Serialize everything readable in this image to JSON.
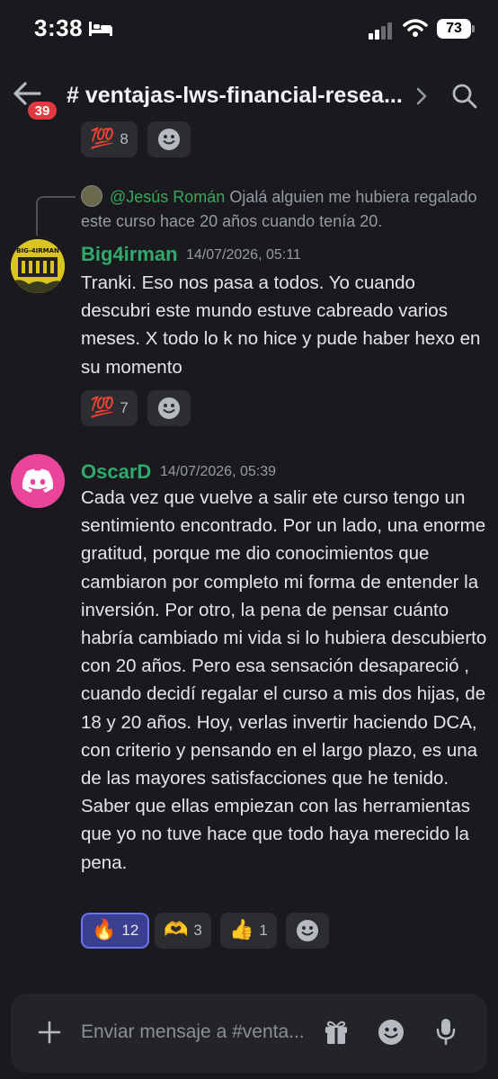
{
  "status_bar": {
    "time": "3:38",
    "battery": "73"
  },
  "header": {
    "unread_badge": "39",
    "channel_name": "# ventajas-lws-financial-resea..."
  },
  "prev_reactions": [
    {
      "emoji": "💯",
      "count": "8"
    }
  ],
  "reply": {
    "author": "@Jesús Román",
    "text": "Ojalá alguien me hubiera regalado este curso hace 20 años cuando tenía 20."
  },
  "messages": [
    {
      "author": "Big4irman",
      "timestamp": "14/07/2026, 05:11",
      "text": "Tranki. Eso nos pasa a todos. Yo cuando descubri este mundo estuve cabreado varios meses. X todo lo k no hice y pude haber hexo en su momento",
      "avatar_text": "BIG-4IRMAN",
      "reactions": [
        {
          "emoji": "💯",
          "count": "7"
        }
      ]
    },
    {
      "author": "OscarD",
      "timestamp": "14/07/2026, 05:39",
      "text": "Cada vez que vuelve a salir ete curso tengo un sentimiento encontrado. Por un lado, una enorme gratitud, porque me dio conocimientos que cambiaron por completo mi forma de entender   la inversión. Por otro, la pena de pensar cuánto habría cambiado mi vida si lo hubiera descubierto con 20 años. Pero esa sensación desapareció , cuando decidí regalar el curso a mis dos hijas, de 18 y 20 años. Hoy, verlas invertir haciendo DCA, con criterio y pensando en el largo plazo, es una de las mayores satisfacciones que he tenido. Saber que ellas empiezan con las herramientas que yo no tuve hace que todo haya merecido la pena.",
      "reactions": [
        {
          "emoji": "🔥",
          "count": "12",
          "active": true
        },
        {
          "emoji": "🫶",
          "count": "3"
        },
        {
          "emoji": "👍",
          "count": "1"
        }
      ]
    }
  ],
  "composer": {
    "placeholder": "Enviar mensaje a #venta..."
  },
  "colors": {
    "background": "#1a1a1e",
    "author_green": "#2faa6b",
    "badge_red": "#e0393e",
    "active_reaction": "#3b3f8f",
    "discord_pink": "#ea459a"
  },
  "icons": [
    "back-arrow-icon",
    "chevron-right-icon",
    "search-icon",
    "smiley-add-icon",
    "discord-logo-icon",
    "plus-icon",
    "gift-icon",
    "emoji-icon",
    "microphone-icon",
    "bed-icon",
    "signal-icon",
    "wifi-icon"
  ]
}
